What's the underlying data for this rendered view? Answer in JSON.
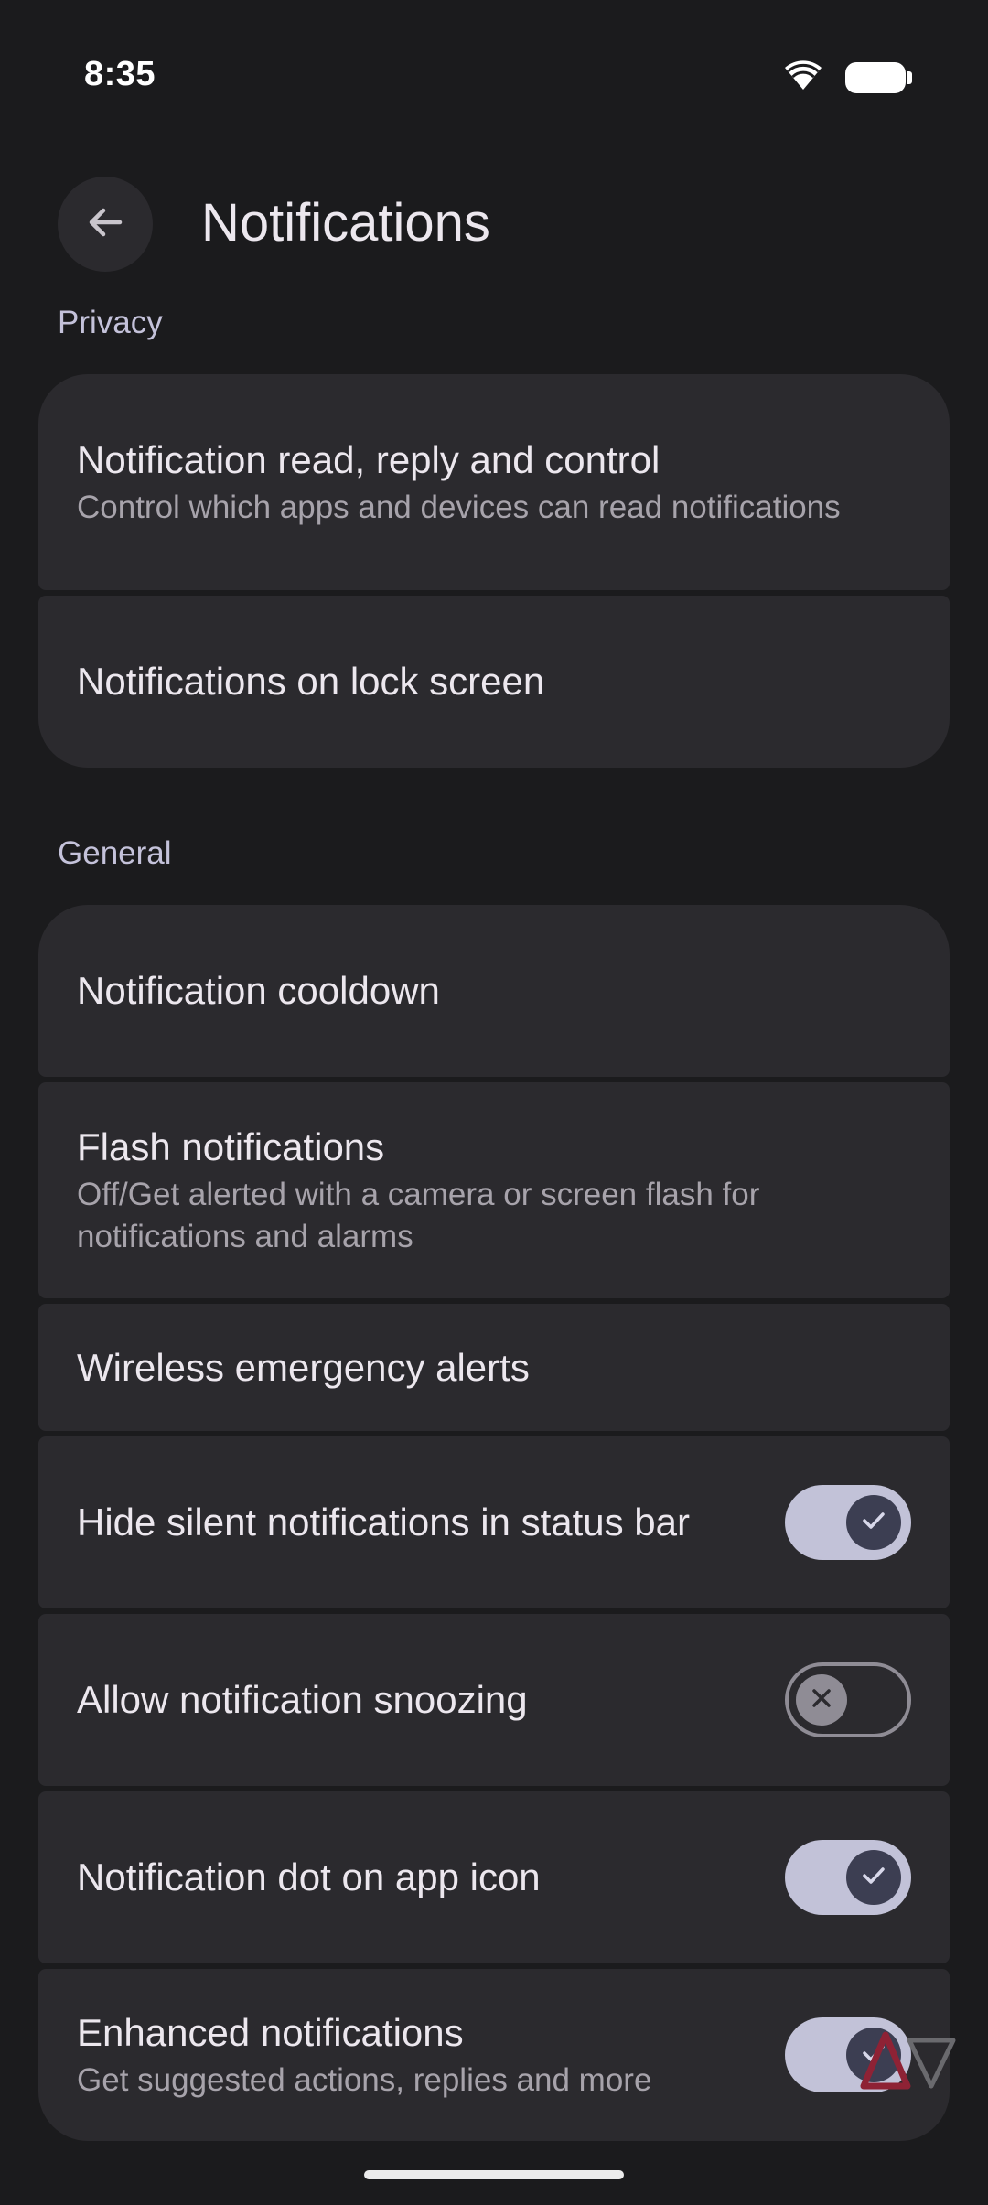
{
  "status_bar": {
    "time": "8:35",
    "icons": [
      "wifi-icon",
      "battery-icon"
    ]
  },
  "header": {
    "back_icon": "arrow-left-icon",
    "title": "Notifications"
  },
  "sections": {
    "privacy": {
      "label": "Privacy",
      "items": [
        {
          "title": "Notification read, reply and control",
          "subtitle": "Control which apps and devices can read notifications"
        },
        {
          "title": "Notifications on lock screen"
        }
      ]
    },
    "general": {
      "label": "General",
      "items": [
        {
          "title": "Notification cooldown"
        },
        {
          "title": "Flash notifications",
          "subtitle": "Off/Get alerted with a camera or screen flash for notifications and alarms"
        },
        {
          "title": "Wireless emergency alerts"
        },
        {
          "title": "Hide silent notifications in status bar",
          "toggle": "on"
        },
        {
          "title": "Allow notification snoozing",
          "toggle": "off"
        },
        {
          "title": "Notification dot on app icon",
          "toggle": "on"
        },
        {
          "title": "Enhanced notifications",
          "subtitle": "Get suggested actions, replies and more",
          "toggle": "on"
        }
      ]
    }
  },
  "colors": {
    "background": "#1b1b1d",
    "card": "#2b2a2e",
    "toggle_on_track": "#c2c2d8",
    "toggle_on_thumb": "#3c3e52",
    "toggle_off_outline": "#8f8c95",
    "section_header": "#c4c2da"
  }
}
